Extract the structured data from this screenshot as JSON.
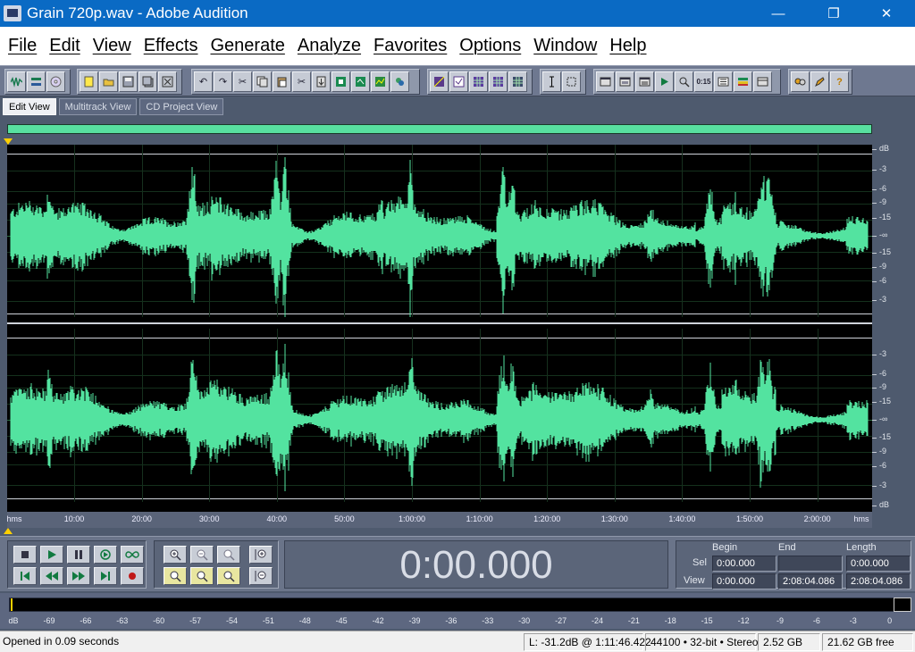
{
  "window": {
    "title": "Grain 720p.wav - Adobe Audition",
    "minimize_glyph": "—",
    "maximize_glyph": "❐",
    "close_glyph": "✕"
  },
  "menu": [
    "File",
    "Edit",
    "View",
    "Effects",
    "Generate",
    "Analyze",
    "Favorites",
    "Options",
    "Window",
    "Help"
  ],
  "view_tabs": [
    "Edit View",
    "Multitrack View",
    "CD Project View"
  ],
  "active_view_tab": "Edit View",
  "db_scale_channel1": [
    "dB",
    "-3",
    "-6",
    "-9",
    "-15",
    "-∞",
    "-15",
    "-9",
    "-6",
    "-3"
  ],
  "db_scale_channel2": [
    "-3",
    "-6",
    "-9",
    "-15",
    "-∞",
    "-15",
    "-9",
    "-6",
    "-3",
    "dB"
  ],
  "time_ruler": [
    "hms",
    "10:00",
    "20:00",
    "30:00",
    "40:00",
    "50:00",
    "1:00:00",
    "1:10:00",
    "1:20:00",
    "1:30:00",
    "1:40:00",
    "1:50:00",
    "2:00:00",
    "hms"
  ],
  "time_display": "0:00.000",
  "selection": {
    "headers": {
      "begin": "Begin",
      "end": "End",
      "length": "Length"
    },
    "sel_label": "Sel",
    "view_label": "View",
    "sel": {
      "begin": "0:00.000",
      "end": "",
      "length": "0:00.000"
    },
    "view": {
      "begin": "0:00.000",
      "end": "2:08:04.086",
      "length": "2:08:04.086"
    }
  },
  "level_meter_labels": [
    "dB",
    "-69",
    "-66",
    "-63",
    "-60",
    "-57",
    "-54",
    "-51",
    "-48",
    "-45",
    "-42",
    "-39",
    "-36",
    "-33",
    "-30",
    "-27",
    "-24",
    "-21",
    "-18",
    "-15",
    "-12",
    "-9",
    "-6",
    "-3",
    "0"
  ],
  "status": {
    "message": "Opened in 0.09 seconds",
    "cursor_level": "L: -31.2dB @ 1:11:46.422",
    "format": "44100 • 32-bit • Stereo",
    "file_size": "2.52 GB",
    "free_space": "21.62 GB free"
  },
  "colors": {
    "waveform": "#53e3a0",
    "titlebar": "#0a6ac4",
    "background": "#4e5a6e"
  },
  "icons": {
    "toolbar_group1": [
      "waveform-view-icon",
      "multitrack-view-icon",
      "cd-view-icon"
    ],
    "toolbar_group2": [
      "new-file-icon",
      "open-file-icon",
      "save-icon",
      "save-all-icon",
      "close-file-icon"
    ],
    "toolbar_group3": [
      "undo-icon",
      "redo-icon",
      "repeat-icon",
      "copy-icon",
      "paste-icon",
      "cut-icon",
      "mix-paste-icon",
      "trim-icon",
      "mono-icon",
      "convert-icon",
      "loop-icon"
    ],
    "toolbar_group4": [
      "spectral-view-icon",
      "check-icon",
      "grid-icon",
      "grid2-icon",
      "grid3-icon"
    ],
    "toolbar_group5": [
      "ibeam-icon",
      "marquee-icon"
    ],
    "toolbar_group6": [
      "window1-icon",
      "window2-icon",
      "window3-icon",
      "play-window-icon",
      "zoom-window-icon",
      "time-window-icon",
      "eq-icon",
      "meters-icon",
      "panel-icon"
    ],
    "toolbar_group7": [
      "scripts-icon",
      "edit-icon",
      "help-icon"
    ]
  }
}
